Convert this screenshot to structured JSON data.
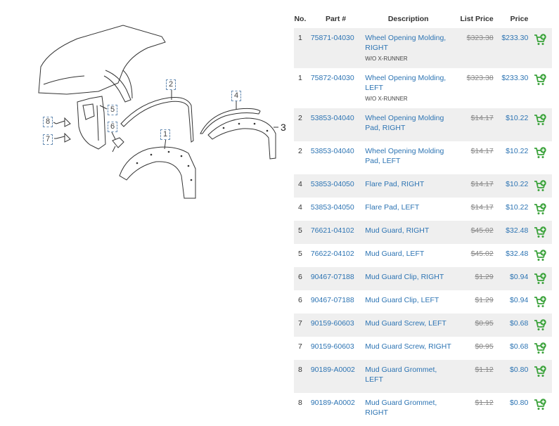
{
  "diagram": {
    "callouts": [
      "1",
      "2",
      "3",
      "4",
      "5",
      "6",
      "7",
      "8"
    ]
  },
  "table": {
    "headers": {
      "no": "No.",
      "part": "Part #",
      "desc": "Description",
      "list": "List Price",
      "price": "Price"
    },
    "rows": [
      {
        "no": "1",
        "part": "75871-04030",
        "desc": "Wheel Opening Molding, RIGHT",
        "note": "W/O X-RUNNER",
        "list": "$323.38",
        "price": "$233.30"
      },
      {
        "no": "1",
        "part": "75872-04030",
        "desc": "Wheel Opening Molding, LEFT",
        "note": "W/O X-RUNNER",
        "list": "$323.38",
        "price": "$233.30"
      },
      {
        "no": "2",
        "part": "53853-04040",
        "desc": "Wheel Opening Molding Pad, RIGHT",
        "note": "",
        "list": "$14.17",
        "price": "$10.22"
      },
      {
        "no": "2",
        "part": "53853-04040",
        "desc": "Wheel Opening Molding Pad, LEFT",
        "note": "",
        "list": "$14.17",
        "price": "$10.22"
      },
      {
        "no": "4",
        "part": "53853-04050",
        "desc": "Flare Pad, RIGHT",
        "note": "",
        "list": "$14.17",
        "price": "$10.22"
      },
      {
        "no": "4",
        "part": "53853-04050",
        "desc": "Flare Pad, LEFT",
        "note": "",
        "list": "$14.17",
        "price": "$10.22"
      },
      {
        "no": "5",
        "part": "76621-04102",
        "desc": "Mud Guard, RIGHT",
        "note": "",
        "list": "$45.02",
        "price": "$32.48"
      },
      {
        "no": "5",
        "part": "76622-04102",
        "desc": "Mud Guard, LEFT",
        "note": "",
        "list": "$45.02",
        "price": "$32.48"
      },
      {
        "no": "6",
        "part": "90467-07188",
        "desc": "Mud Guard Clip, RIGHT",
        "note": "",
        "list": "$1.29",
        "price": "$0.94"
      },
      {
        "no": "6",
        "part": "90467-07188",
        "desc": "Mud Guard Clip, LEFT",
        "note": "",
        "list": "$1.29",
        "price": "$0.94"
      },
      {
        "no": "7",
        "part": "90159-60603",
        "desc": "Mud Guard Screw, LEFT",
        "note": "",
        "list": "$0.95",
        "price": "$0.68"
      },
      {
        "no": "7",
        "part": "90159-60603",
        "desc": "Mud Guard Screw, RIGHT",
        "note": "",
        "list": "$0.95",
        "price": "$0.68"
      },
      {
        "no": "8",
        "part": "90189-A0002",
        "desc": "Mud Guard Grommet, LEFT",
        "note": "",
        "list": "$1.12",
        "price": "$0.80"
      },
      {
        "no": "8",
        "part": "90189-A0002",
        "desc": "Mud Guard Grommet, RIGHT",
        "note": "",
        "list": "$1.12",
        "price": "$0.80"
      }
    ]
  },
  "icons": {
    "cart": "add-to-cart-icon"
  },
  "colors": {
    "link": "#2d74b3",
    "cart": "#3ca33c",
    "row_alt": "#efefef"
  }
}
